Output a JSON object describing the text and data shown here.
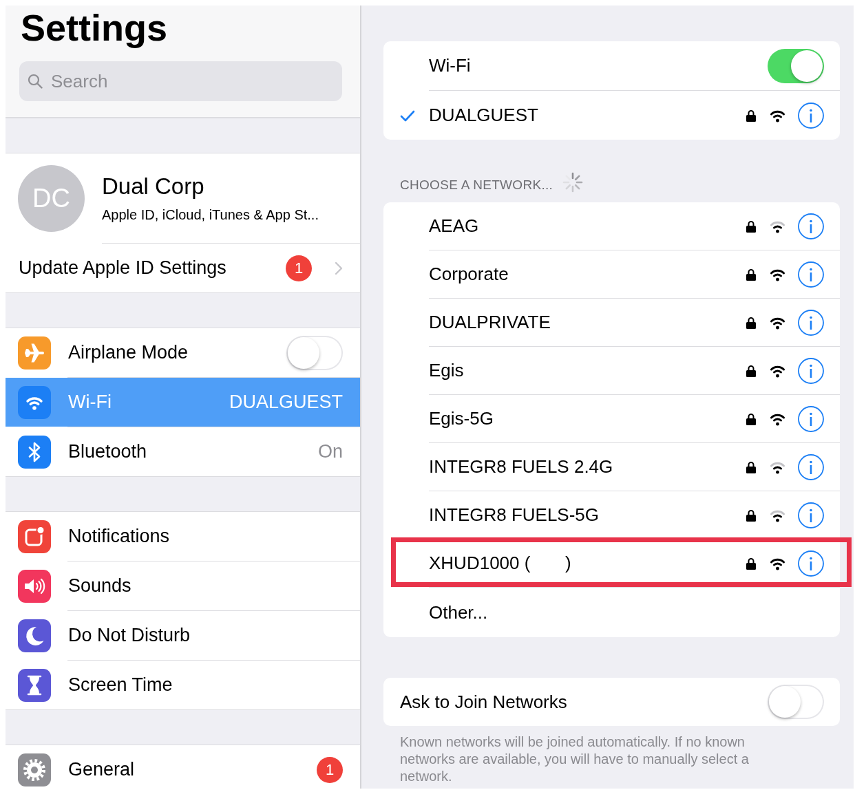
{
  "sidebar": {
    "title": "Settings",
    "search": {
      "placeholder": "Search"
    },
    "profile": {
      "initials": "DC",
      "name": "Dual Corp",
      "subtitle": "Apple ID, iCloud, iTunes & App St..."
    },
    "update_row": {
      "label": "Update Apple ID Settings",
      "badge": "1"
    },
    "groups": [
      {
        "items": [
          {
            "kind": "toggle",
            "label": "Airplane Mode",
            "on": false,
            "selected": false
          },
          {
            "kind": "value",
            "label": "Wi-Fi",
            "value": "DUALGUEST",
            "selected": true
          },
          {
            "kind": "value",
            "label": "Bluetooth",
            "value": "On",
            "selected": false
          }
        ]
      },
      {
        "items": [
          {
            "kind": "plain",
            "label": "Notifications",
            "selected": false
          },
          {
            "kind": "plain",
            "label": "Sounds",
            "selected": false
          },
          {
            "kind": "plain",
            "label": "Do Not Disturb",
            "selected": false
          },
          {
            "kind": "plain",
            "label": "Screen Time",
            "selected": false
          }
        ]
      },
      {
        "items": [
          {
            "kind": "badge",
            "label": "General",
            "badge": "1",
            "selected": false
          }
        ]
      }
    ]
  },
  "wifi_panel": {
    "wifi": {
      "label": "Wi-Fi",
      "on": true
    },
    "current_network": {
      "name": "DUALGUEST",
      "connected": true,
      "locked": true,
      "weak_signal": false
    },
    "section_header": "CHOOSE A NETWORK...",
    "networks": [
      {
        "name": "AEAG",
        "locked": true,
        "weak_signal": true,
        "highlighted": false
      },
      {
        "name": "Corporate",
        "locked": true,
        "weak_signal": false,
        "highlighted": false
      },
      {
        "name": "DUALPRIVATE",
        "locked": true,
        "weak_signal": false,
        "highlighted": false
      },
      {
        "name": "Egis",
        "locked": true,
        "weak_signal": false,
        "highlighted": false
      },
      {
        "name": "Egis-5G",
        "locked": true,
        "weak_signal": false,
        "highlighted": false
      },
      {
        "name": "INTEGR8 FUELS 2.4G",
        "locked": true,
        "weak_signal": true,
        "highlighted": false
      },
      {
        "name": "INTEGR8 FUELS-5G",
        "locked": true,
        "weak_signal": true,
        "highlighted": false
      },
      {
        "name": "XHUD1000 (       )",
        "locked": true,
        "weak_signal": false,
        "highlighted": true
      }
    ],
    "other": "Other...",
    "ask_to_join": {
      "label": "Ask to Join Networks",
      "on": false
    },
    "footer": "Known networks will be joined automatically. If no known networks are available, you will have to manually select a network."
  }
}
